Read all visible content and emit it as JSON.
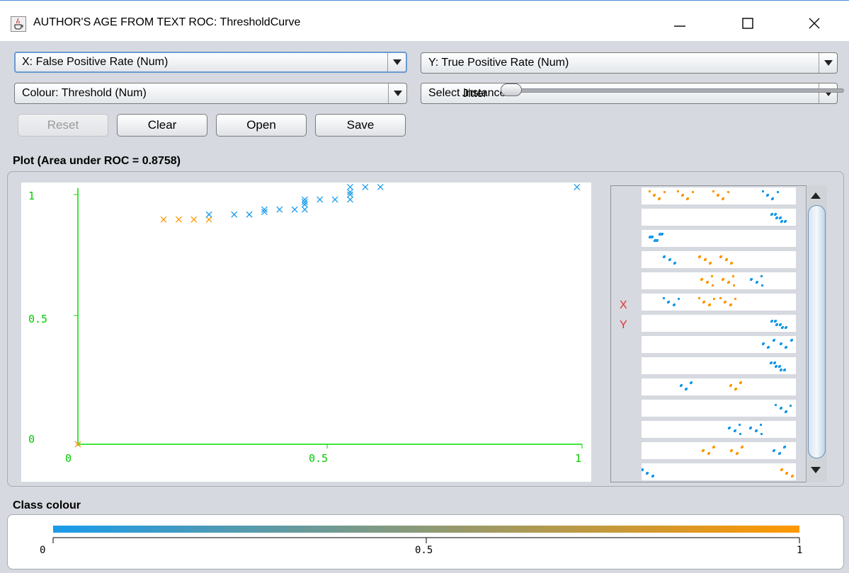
{
  "window": {
    "title": "AUTHOR'S AGE FROM TEXT ROC: ThresholdCurve",
    "icon": "java-cup-icon",
    "controls": [
      "minimize-icon",
      "maximize-icon",
      "close-icon"
    ]
  },
  "selectors": {
    "x_axis": "X: False Positive Rate (Num)",
    "y_axis": "Y: True Positive Rate (Num)",
    "colour": "Colour: Threshold (Num)",
    "instance": "Select Instance"
  },
  "buttons": {
    "reset": "Reset",
    "clear": "Clear",
    "open": "Open",
    "save": "Save"
  },
  "jitter": {
    "label": "Jitter",
    "value": 0
  },
  "plot": {
    "title": "Plot (Area under ROC = 0.8758)",
    "x_ticks": [
      "0",
      "0.5",
      "1"
    ],
    "y_ticks": [
      "1",
      "0.5",
      "0"
    ],
    "axis_color": "#00dd00",
    "point_colors": {
      "low": "#1a9bea",
      "high": "#ff9800"
    }
  },
  "mini_plots": {
    "labels": [
      "X",
      "Y"
    ],
    "label_color": "#e03030"
  },
  "class_colour": {
    "title": "Class colour",
    "ticks": [
      "0",
      "0.5",
      "1"
    ],
    "gradient": [
      "#1a9bea",
      "#ff9800"
    ]
  },
  "chart_data": {
    "type": "scatter",
    "title": "Plot (Area under ROC = 0.8758)",
    "xlabel": "",
    "ylabel": "",
    "xlim": [
      0,
      1
    ],
    "ylim": [
      0,
      1
    ],
    "series": [
      {
        "color": "#ff9800",
        "x": [
          0.0,
          0.17,
          0.2,
          0.23,
          0.26
        ],
        "y": [
          0.0,
          0.9,
          0.9,
          0.9,
          0.9
        ]
      },
      {
        "color": "#1a9bea",
        "x": [
          0.26,
          0.31,
          0.34,
          0.37,
          0.37,
          0.4,
          0.43,
          0.45,
          0.45,
          0.45,
          0.45,
          0.48,
          0.51,
          0.54,
          0.54,
          0.54,
          0.54,
          0.57,
          0.6,
          0.99
        ],
        "y": [
          0.92,
          0.92,
          0.92,
          0.93,
          0.94,
          0.94,
          0.94,
          0.94,
          0.96,
          0.97,
          0.98,
          0.98,
          0.98,
          0.98,
          1.0,
          1.01,
          1.03,
          1.03,
          1.03,
          1.03
        ]
      }
    ]
  }
}
